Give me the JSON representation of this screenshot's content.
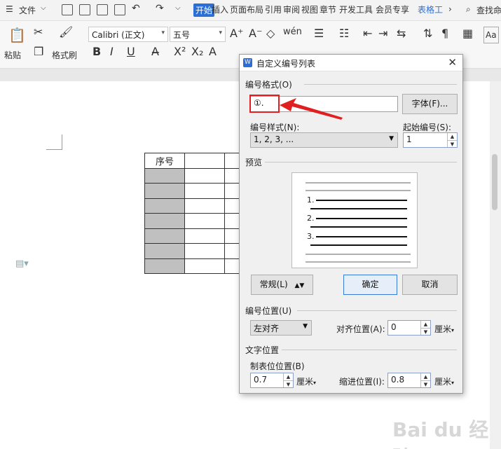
{
  "menubar": {
    "hamburger_icon": "menu-icon",
    "file_label": "文件",
    "tabs": [
      "开始",
      "插入",
      "页面布局",
      "引用",
      "审阅",
      "视图",
      "章节",
      "开发工具",
      "会员专享",
      "表格工"
    ],
    "active_tab": "开始",
    "search_placeholder": "查找命"
  },
  "ribbon": {
    "paste_label": "粘贴",
    "format_painter_label": "格式刷",
    "font_name": "Calibri (正文)",
    "font_size": "五号"
  },
  "document": {
    "table_header": "序号"
  },
  "dialog": {
    "title": "自定义编号列表",
    "number_format_section": "编号格式(O)",
    "number_format_value": "①.",
    "font_button": "字体(F)...",
    "number_style_label": "编号样式(N):",
    "number_style_value": "1, 2, 3, ...",
    "start_number_label": "起始编号(S):",
    "start_number_value": "1",
    "preview_section": "预览",
    "preview_items": [
      "1.",
      "2.",
      "3."
    ],
    "normal_button": "常规(L)",
    "ok_button": "确定",
    "cancel_button": "取消",
    "number_position_section": "编号位置(U)",
    "alignment_value": "左对齐",
    "align_position_label": "对齐位置(A):",
    "align_position_value": "0",
    "unit_cm": "厘米",
    "text_position_section": "文字位置",
    "tab_position_label": "制表位位置(B)",
    "tab_position_value": "0.7",
    "indent_position_label": "缩进位置(I):",
    "indent_position_value": "0.8"
  },
  "watermark": "Bai du 经验",
  "colors": {
    "accent": "#2b6fd6",
    "annotation_red": "#e02020"
  }
}
